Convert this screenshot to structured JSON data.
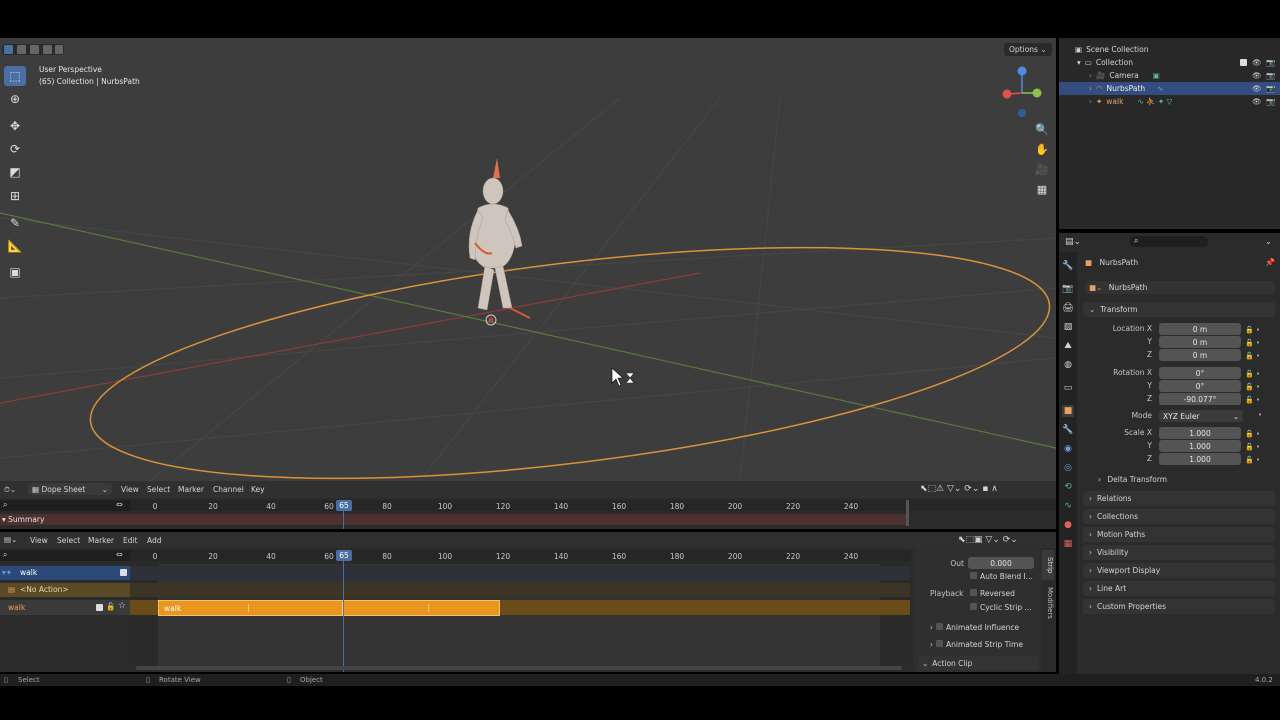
{
  "viewport": {
    "view_name": "User Perspective",
    "collection_info": "(65) Collection | NurbsPath",
    "options_label": "Options"
  },
  "outliner": {
    "scene_collection": "Scene Collection",
    "collection": "Collection",
    "items": [
      {
        "label": "Camera"
      },
      {
        "label": "NurbsPath"
      },
      {
        "label": "walk"
      }
    ]
  },
  "properties": {
    "object_name_top": "NurbsPath",
    "object_name": "NurbsPath",
    "transform_label": "Transform",
    "location_x_label": "Location X",
    "y_label": "Y",
    "z_label": "Z",
    "location": [
      "0 m",
      "0 m",
      "0 m"
    ],
    "rotation_x_label": "Rotation X",
    "rotation": [
      "0°",
      "0°",
      "-90.077°"
    ],
    "mode_label": "Mode",
    "mode_value": "XYZ Euler",
    "scale_x_label": "Scale X",
    "scale": [
      "1.000",
      "1.000",
      "1.000"
    ],
    "delta_transform": "Delta Transform",
    "panels": [
      "Relations",
      "Collections",
      "Motion Paths",
      "Visibility",
      "Viewport Display",
      "Line Art",
      "Custom Properties"
    ]
  },
  "dopesheet": {
    "mode": "Dope Sheet",
    "menu": [
      "View",
      "Select",
      "Marker",
      "Channel",
      "Key"
    ],
    "summary": "Summary",
    "current_frame": "65",
    "ruler": [
      "0",
      "20",
      "40",
      "60",
      "80",
      "100",
      "120",
      "140",
      "160",
      "180",
      "200",
      "220",
      "240"
    ]
  },
  "nla": {
    "menu": [
      "View",
      "Select",
      "Marker",
      "Edit",
      "Add"
    ],
    "current_frame": "65",
    "ruler": [
      "0",
      "20",
      "40",
      "60",
      "80",
      "100",
      "120",
      "140",
      "160",
      "180",
      "200",
      "220",
      "240"
    ],
    "track_object": "walk",
    "no_action": "<No Action>",
    "track_name": "walk",
    "strip_label": "walk",
    "sidebar": {
      "out_label": "Out",
      "out_value": "0.000",
      "auto_blend": "Auto Blend I...",
      "playback_label": "Playback",
      "reversed": "Reversed",
      "cyclic": "Cyclic Strip ...",
      "animated_influence": "Animated Influence",
      "animated_strip_time": "Animated Strip Time",
      "action_clip": "Action Clip",
      "tab_strip": "Strip",
      "tab_modifiers": "Modifiers"
    }
  },
  "statusbar": {
    "select": "Select",
    "rotate": "Rotate View",
    "object": "Object",
    "version": "4.0.2"
  },
  "colors": {
    "accent_blue": "#4a6fa5",
    "strip_orange": "#e8961e",
    "path_orange": "#d9913a"
  }
}
